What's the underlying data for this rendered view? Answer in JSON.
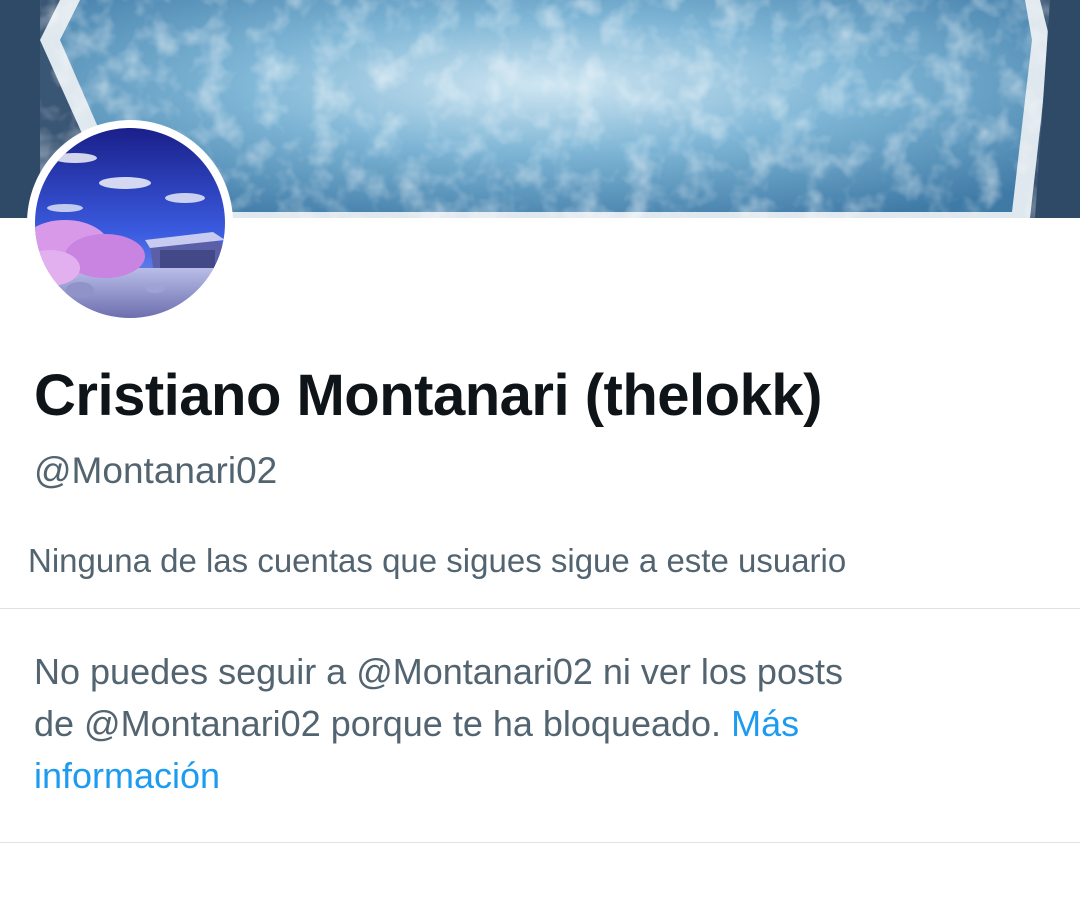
{
  "profile": {
    "display_name": "Cristiano Montanari (thelokk)",
    "handle": "@Montanari02",
    "followers_you_know": "Ninguna de las cuentas que sigues sigue a este usuario"
  },
  "blocked": {
    "line1": "No puedes seguir a @Montanari02 ni ver los posts",
    "line2": "de @Montanari02 porque te ha bloqueado.",
    "link_text_1": "Más",
    "link_text_2": "información"
  },
  "colors": {
    "name": "#0f1419",
    "secondary_text": "#536471",
    "link": "#1d9bf0",
    "divider": "#dfe3e6"
  }
}
